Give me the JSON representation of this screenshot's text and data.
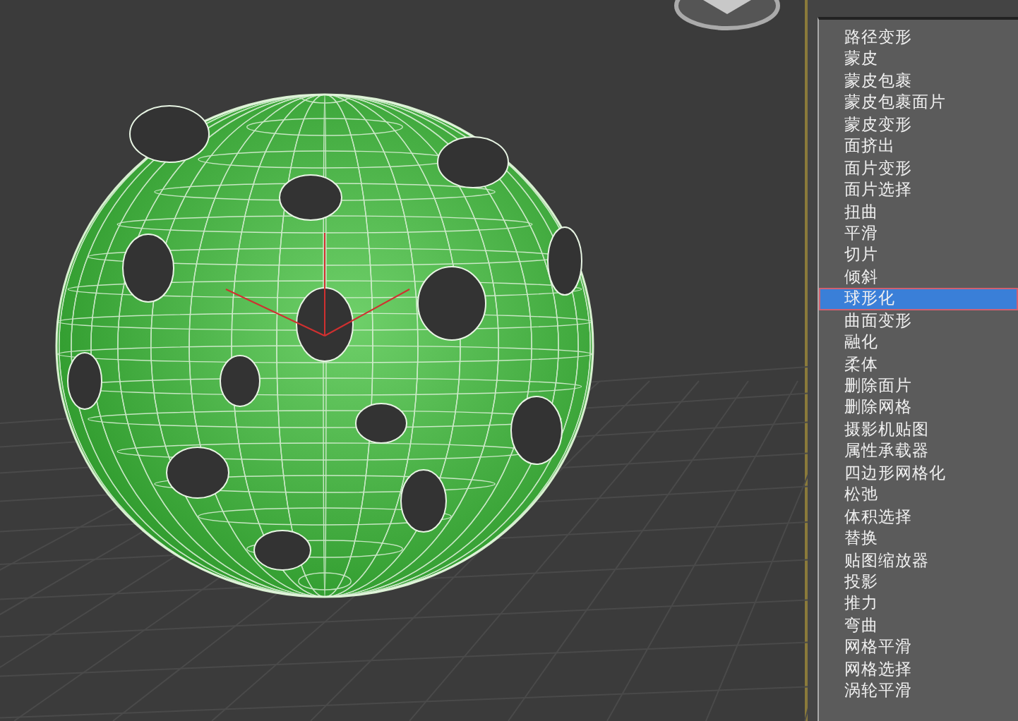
{
  "modifier_list": {
    "items": [
      {
        "label": "路径变形",
        "selected": false
      },
      {
        "label": "蒙皮",
        "selected": false
      },
      {
        "label": "蒙皮包裹",
        "selected": false
      },
      {
        "label": "蒙皮包裹面片",
        "selected": false
      },
      {
        "label": "蒙皮变形",
        "selected": false
      },
      {
        "label": "面挤出",
        "selected": false
      },
      {
        "label": "面片变形",
        "selected": false
      },
      {
        "label": "面片选择",
        "selected": false
      },
      {
        "label": "扭曲",
        "selected": false
      },
      {
        "label": "平滑",
        "selected": false
      },
      {
        "label": "切片",
        "selected": false
      },
      {
        "label": "倾斜",
        "selected": false
      },
      {
        "label": "球形化",
        "selected": true
      },
      {
        "label": "曲面变形",
        "selected": false
      },
      {
        "label": "融化",
        "selected": false
      },
      {
        "label": "柔体",
        "selected": false
      },
      {
        "label": "删除面片",
        "selected": false
      },
      {
        "label": "删除网格",
        "selected": false
      },
      {
        "label": "摄影机贴图",
        "selected": false
      },
      {
        "label": "属性承载器",
        "selected": false
      },
      {
        "label": "四边形网格化",
        "selected": false
      },
      {
        "label": "松弛",
        "selected": false
      },
      {
        "label": "体积选择",
        "selected": false
      },
      {
        "label": "替换",
        "selected": false
      },
      {
        "label": "贴图缩放器",
        "selected": false
      },
      {
        "label": "投影",
        "selected": false
      },
      {
        "label": "推力",
        "selected": false
      },
      {
        "label": "弯曲",
        "selected": false
      },
      {
        "label": "网格平滑",
        "selected": false
      },
      {
        "label": "网格选择",
        "selected": false
      },
      {
        "label": "涡轮平滑",
        "selected": false
      }
    ]
  }
}
